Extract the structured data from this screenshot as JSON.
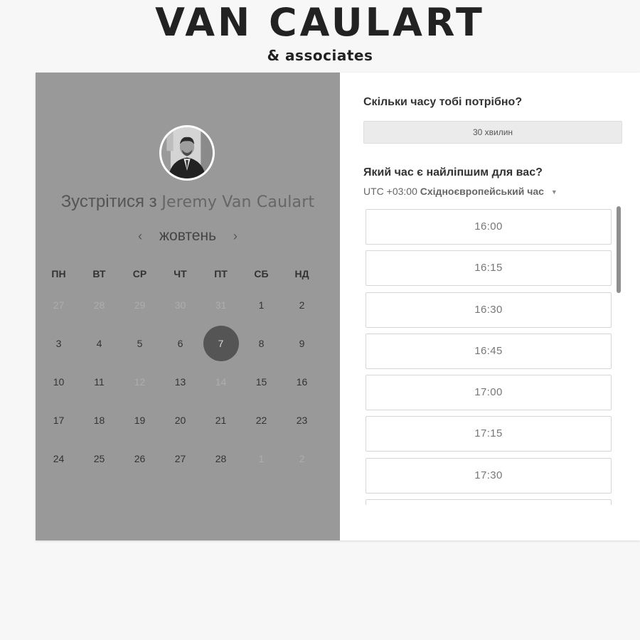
{
  "brand": {
    "title": "VAN CAULART",
    "subtitle": "& associates"
  },
  "host": {
    "meet_prefix": "Зустрітися з",
    "name": "Jeremy Van Caulart",
    "avatar_icon": "person-photo-icon"
  },
  "calendar": {
    "month": "жовтень",
    "prev_icon": "‹",
    "next_icon": "›",
    "weekdays": [
      "ПН",
      "ВТ",
      "СР",
      "ЧТ",
      "ПТ",
      "СБ",
      "НД"
    ],
    "weeks": [
      [
        {
          "d": "27",
          "m": true
        },
        {
          "d": "28",
          "m": true
        },
        {
          "d": "29",
          "m": true
        },
        {
          "d": "30",
          "m": true
        },
        {
          "d": "31",
          "m": true
        },
        {
          "d": "1",
          "m": false
        },
        {
          "d": "2",
          "m": false
        }
      ],
      [
        {
          "d": "3",
          "m": false
        },
        {
          "d": "4",
          "m": false
        },
        {
          "d": "5",
          "m": false
        },
        {
          "d": "6",
          "m": false
        },
        {
          "d": "7",
          "m": false,
          "s": true
        },
        {
          "d": "8",
          "m": false
        },
        {
          "d": "9",
          "m": false
        }
      ],
      [
        {
          "d": "10",
          "m": false
        },
        {
          "d": "11",
          "m": false
        },
        {
          "d": "12",
          "m": true
        },
        {
          "d": "13",
          "m": false
        },
        {
          "d": "14",
          "m": true
        },
        {
          "d": "15",
          "m": false
        },
        {
          "d": "16",
          "m": false
        }
      ],
      [
        {
          "d": "17",
          "m": false
        },
        {
          "d": "18",
          "m": false
        },
        {
          "d": "19",
          "m": false
        },
        {
          "d": "20",
          "m": false
        },
        {
          "d": "21",
          "m": false
        },
        {
          "d": "22",
          "m": false
        },
        {
          "d": "23",
          "m": false
        }
      ],
      [
        {
          "d": "24",
          "m": false
        },
        {
          "d": "25",
          "m": false
        },
        {
          "d": "26",
          "m": false
        },
        {
          "d": "27",
          "m": false
        },
        {
          "d": "28",
          "m": false
        },
        {
          "d": "1",
          "m": true
        },
        {
          "d": "2",
          "m": true
        }
      ]
    ],
    "selected_color": "#555555"
  },
  "booking": {
    "duration_question": "Скільки часу тобі потрібно?",
    "duration_value": "30 хвилин",
    "time_question": "Який час є найліпшим для вас?",
    "tz_offset": "UTC +03:00",
    "tz_name": "Східноєвропейський час",
    "tz_caret_icon": "▼",
    "slots": [
      "16:00",
      "16:15",
      "16:30",
      "16:45",
      "17:00",
      "17:15",
      "17:30",
      ""
    ]
  },
  "colors": {
    "left_panel": "#999999",
    "page_bg": "#f7f7f7"
  }
}
